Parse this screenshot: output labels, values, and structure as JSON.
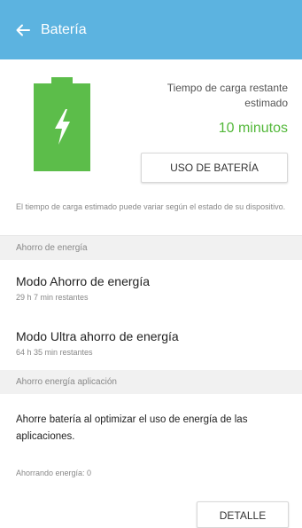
{
  "appbar": {
    "title": "Batería",
    "back_icon": "arrow-left-icon",
    "background": "#5cb3e0"
  },
  "battery": {
    "icon": "battery-charging-icon",
    "color": "#5cbd4a",
    "charge_time_label": "Tiempo de carga restante estimado",
    "charge_time_value": "10 minutos",
    "charge_time_color": "#53b83a",
    "usage_button_label": "USO DE BATERÍA",
    "note": "El tiempo de carga estimado puede variar según el estado de su dispositivo."
  },
  "power_saving": {
    "header": "Ahorro de energía",
    "items": [
      {
        "title": "Modo Ahorro de energía",
        "subtitle": "29 h 7 min restantes"
      },
      {
        "title": "Modo Ultra ahorro de energía",
        "subtitle": "64 h 35 min restantes"
      }
    ]
  },
  "app_saving": {
    "header": "Ahorro energía aplicación",
    "description": "Ahorre batería al optimizar el uso de energía de las aplicaciones.",
    "status": "Ahorrando energía: 0",
    "detail_button_label": "DETALLE"
  }
}
